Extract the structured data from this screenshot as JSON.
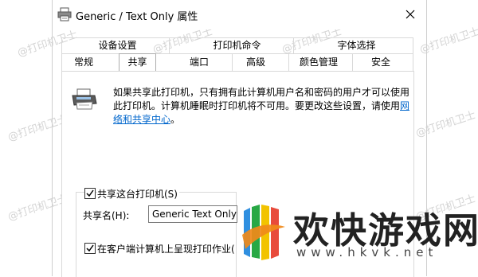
{
  "window": {
    "title": "Generic / Text Only 属性",
    "close_glyph": "✕"
  },
  "tabs": {
    "row1": [
      "设备设置",
      "打印机命令",
      "字体选择"
    ],
    "row2": [
      "常规",
      "共享",
      "端口",
      "高级",
      "颜色管理",
      "安全"
    ],
    "active": "共享"
  },
  "share": {
    "description": "如果共享此打印机，只有拥有此计算机用户名和密码的用户才可以使用此打印机。计算机睡眠时打印机将不可用。要更改这些设置，请使用",
    "link_text": "网络和共享中心",
    "description_end": "。",
    "share_checkbox_label": "共享这台打印机(S)",
    "share_checkbox_checked": true,
    "share_name_label": "共享名(H):",
    "share_name_value": "Generic  Text Only",
    "render_checkbox_label": "在客户端计算机上呈现打印作业(",
    "render_checkbox_checked": true
  },
  "watermark": {
    "text": "@打印机卫士"
  },
  "brand": {
    "name": "欢快游戏网",
    "url": "www.hkvk.net"
  },
  "icons": {
    "title_icon": "printer-icon",
    "share_icon": "printer-icon",
    "close_icon": "close-icon"
  },
  "colors": {
    "link": "#0066cc",
    "watermark": "#d4d4d4"
  }
}
